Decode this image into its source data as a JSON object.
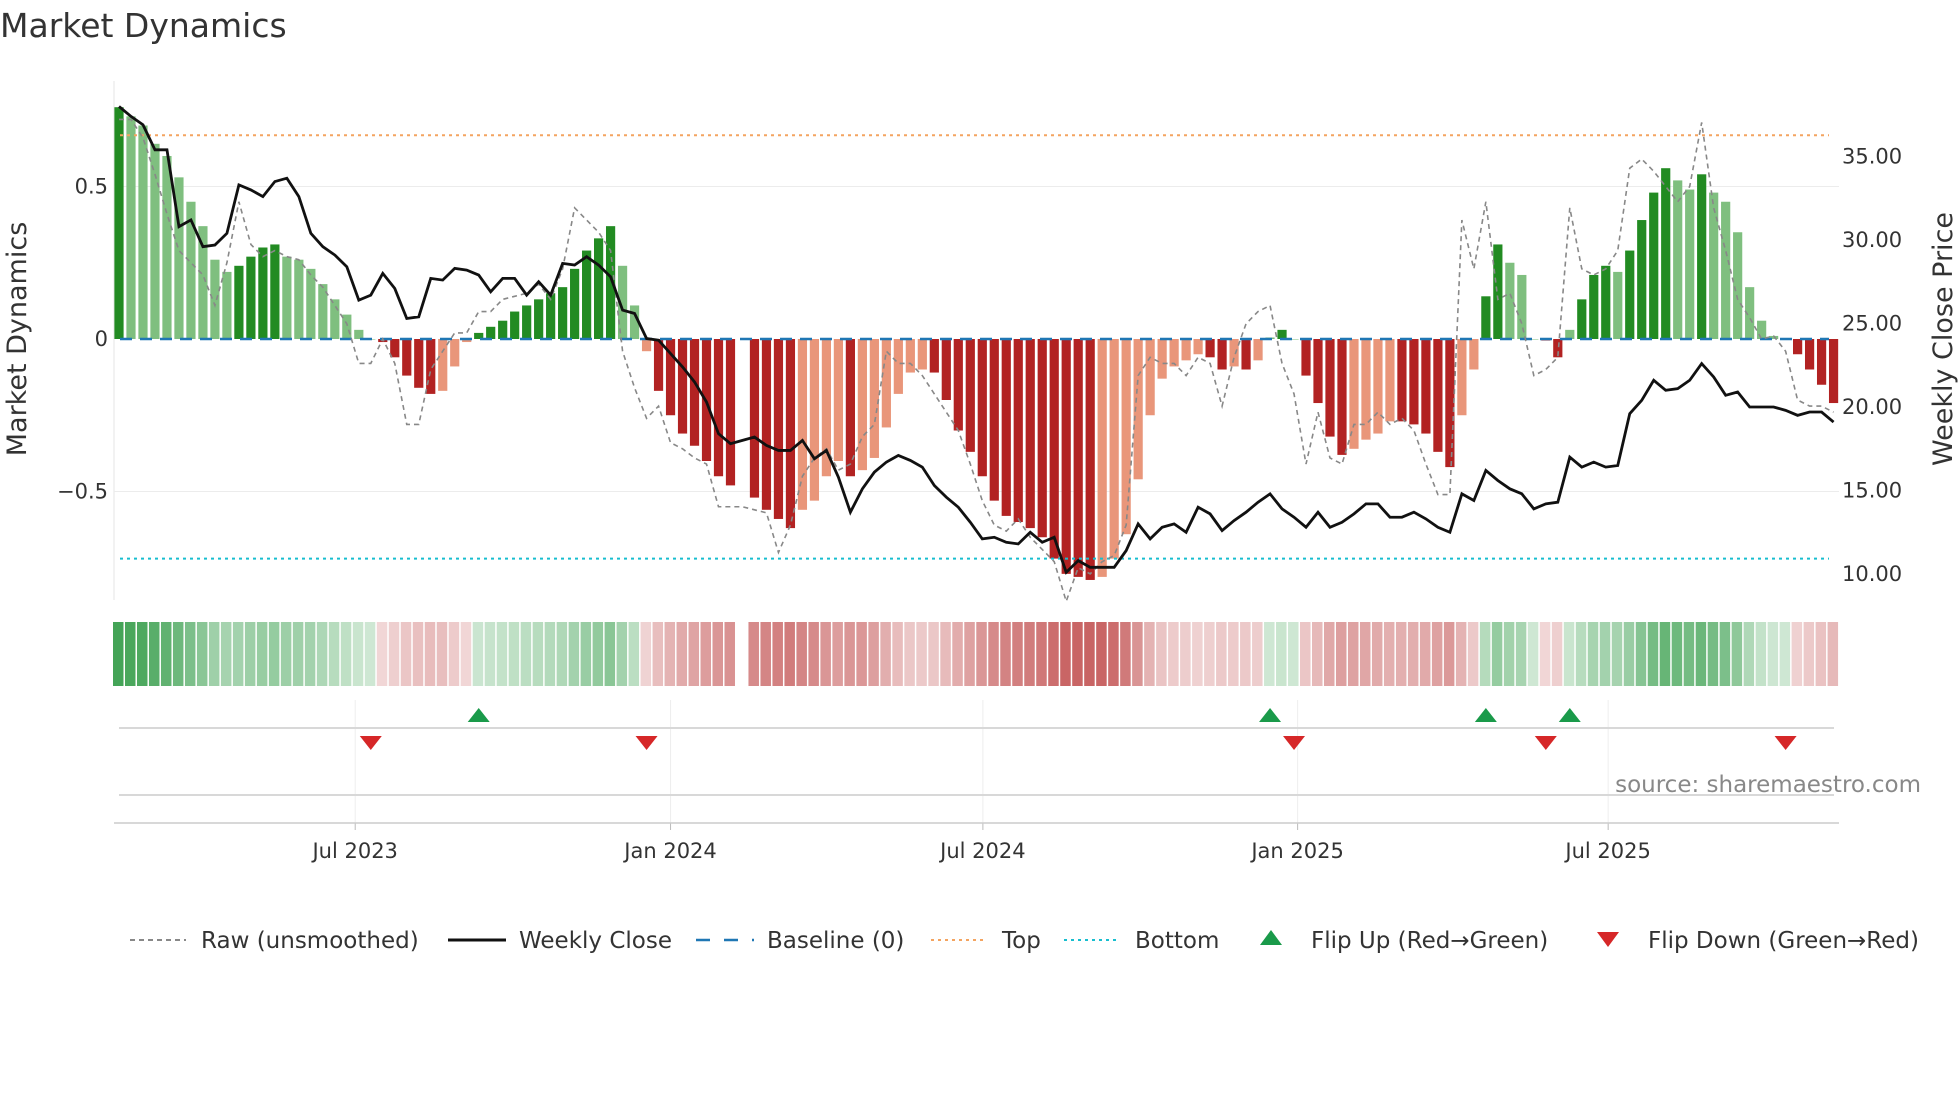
{
  "title": "Market Dynamics",
  "source": "source: sharemaestro.com",
  "colors": {
    "up_strong": "#228b22",
    "up_weak": "#7fbf7f",
    "down_strong": "#b22222",
    "down_weak": "#e9967a",
    "baseline": "#1f77b4",
    "top": "#f4a460",
    "bottom": "#17becf",
    "flip_up": "#1a9a4a",
    "flip_down": "#d62728",
    "close": "#111111",
    "raw": "#888888"
  },
  "chart_data": {
    "type": "bar",
    "title": "Market Dynamics",
    "ylabel": "Market Dynamics",
    "y2label": "Weekly Close Price",
    "ylim": [
      -0.86,
      0.84
    ],
    "y2lim": [
      8.6,
      39.0
    ],
    "yticks": [
      {
        "v": 0.5,
        "label": "0.5"
      },
      {
        "v": 0,
        "label": "0"
      },
      {
        "v": -0.5,
        "label": "−0.5"
      }
    ],
    "y2ticks": [
      {
        "v": 35,
        "label": "35.00"
      },
      {
        "v": 30,
        "label": "30.00"
      },
      {
        "v": 25,
        "label": "25.00"
      },
      {
        "v": 20,
        "label": "20.00"
      },
      {
        "v": 15,
        "label": "15.00"
      },
      {
        "v": 10,
        "label": "10.00"
      }
    ],
    "xticks": [
      {
        "week": 19.7,
        "label": "Jul 2023"
      },
      {
        "week": 46.0,
        "label": "Jan 2024"
      },
      {
        "week": 72.05,
        "label": "Jul 2024"
      },
      {
        "week": 98.3,
        "label": "Jan 2025"
      },
      {
        "week": 124.2,
        "label": "Jul 2025"
      }
    ],
    "top": 0.668,
    "bottom": -0.72,
    "baseline": 0,
    "momentum": [
      0.76,
      0.73,
      0.7,
      0.64,
      0.6,
      0.53,
      0.45,
      0.37,
      0.26,
      0.22,
      0.24,
      0.27,
      0.3,
      0.31,
      0.27,
      0.26,
      0.23,
      0.18,
      0.13,
      0.08,
      0.03,
      0.0,
      -0.01,
      -0.06,
      -0.12,
      -0.16,
      -0.18,
      -0.17,
      -0.09,
      -0.01,
      0.02,
      0.04,
      0.06,
      0.09,
      0.11,
      0.13,
      0.15,
      0.17,
      0.23,
      0.29,
      0.33,
      0.37,
      0.24,
      0.11,
      -0.04,
      -0.17,
      -0.25,
      -0.31,
      -0.35,
      -0.4,
      -0.45,
      -0.48,
      null,
      -0.52,
      -0.56,
      -0.59,
      -0.62,
      -0.56,
      -0.53,
      -0.45,
      -0.4,
      -0.45,
      -0.43,
      -0.39,
      -0.29,
      -0.18,
      -0.11,
      -0.1,
      -0.11,
      -0.2,
      -0.3,
      -0.37,
      -0.45,
      -0.53,
      -0.58,
      -0.6,
      -0.62,
      -0.65,
      -0.72,
      -0.77,
      -0.78,
      -0.79,
      -0.78,
      -0.72,
      -0.64,
      -0.46,
      -0.25,
      -0.13,
      -0.09,
      -0.07,
      -0.05,
      -0.06,
      -0.1,
      -0.09,
      -0.1,
      -0.07,
      0.005,
      0.03,
      0.0,
      -0.12,
      -0.21,
      -0.32,
      -0.38,
      -0.36,
      -0.33,
      -0.31,
      -0.27,
      -0.27,
      -0.28,
      -0.31,
      -0.37,
      -0.42,
      -0.25,
      -0.1,
      0.14,
      0.31,
      0.25,
      0.21,
      0.0,
      -0.005,
      -0.06,
      0.03,
      0.13,
      0.21,
      0.24,
      0.22,
      0.29,
      0.39,
      0.48,
      0.56,
      0.52,
      0.49,
      0.54,
      0.48,
      0.45,
      0.35,
      0.17,
      0.06,
      0.01,
      0.0,
      -0.05,
      -0.1,
      -0.15,
      -0.21
    ],
    "raw": [
      0.72,
      0.72,
      0.66,
      0.54,
      0.41,
      0.29,
      0.25,
      0.21,
      0.11,
      0.25,
      0.45,
      0.31,
      0.27,
      0.29,
      0.27,
      0.26,
      0.21,
      0.17,
      0.11,
      0.05,
      -0.08,
      -0.08,
      0.0,
      -0.08,
      -0.28,
      -0.28,
      -0.1,
      -0.04,
      0.02,
      0.02,
      0.09,
      0.09,
      0.13,
      0.14,
      0.15,
      0.18,
      0.13,
      0.23,
      0.43,
      0.39,
      0.35,
      0.29,
      -0.04,
      -0.16,
      -0.26,
      -0.22,
      -0.34,
      -0.36,
      -0.39,
      -0.41,
      -0.55,
      -0.55,
      -0.55,
      -0.56,
      -0.57,
      -0.7,
      -0.61,
      -0.45,
      -0.39,
      -0.36,
      -0.43,
      -0.41,
      -0.32,
      -0.28,
      -0.04,
      -0.08,
      -0.08,
      -0.12,
      -0.18,
      -0.24,
      -0.3,
      -0.41,
      -0.53,
      -0.61,
      -0.63,
      -0.59,
      -0.65,
      -0.69,
      -0.73,
      -0.86,
      -0.75,
      -0.77,
      -0.73,
      -0.71,
      -0.61,
      -0.12,
      -0.06,
      -0.08,
      -0.08,
      -0.12,
      -0.06,
      -0.08,
      -0.22,
      -0.06,
      0.05,
      0.09,
      0.11,
      -0.08,
      -0.18,
      -0.41,
      -0.24,
      -0.39,
      -0.41,
      -0.28,
      -0.28,
      -0.24,
      -0.28,
      -0.26,
      -0.3,
      -0.41,
      -0.51,
      -0.51,
      0.39,
      0.23,
      0.45,
      0.13,
      0.15,
      0.05,
      -0.12,
      -0.1,
      -0.06,
      0.43,
      0.23,
      0.21,
      0.23,
      0.29,
      0.56,
      0.59,
      0.55,
      0.5,
      0.45,
      0.5,
      0.71,
      0.43,
      0.29,
      0.13,
      0.07,
      0.0,
      0.01,
      -0.04,
      -0.2,
      -0.22,
      -0.22,
      -0.24
    ],
    "close": [
      38.0,
      37.4,
      36.9,
      35.4,
      35.4,
      30.8,
      31.2,
      29.6,
      29.7,
      30.4,
      33.3,
      33.0,
      32.6,
      33.5,
      33.7,
      32.6,
      30.4,
      29.6,
      29.1,
      28.4,
      26.4,
      26.7,
      28.0,
      27.1,
      25.3,
      25.4,
      27.7,
      27.6,
      28.3,
      28.2,
      27.9,
      26.9,
      27.7,
      27.7,
      26.7,
      27.5,
      26.7,
      28.6,
      28.5,
      29.0,
      28.5,
      27.8,
      25.8,
      25.6,
      24.1,
      24.0,
      23.2,
      22.4,
      21.5,
      20.3,
      18.4,
      17.8,
      18.0,
      18.2,
      17.7,
      17.4,
      17.4,
      18.0,
      16.9,
      17.4,
      15.8,
      13.7,
      15.1,
      16.1,
      16.7,
      17.1,
      16.8,
      16.4,
      15.3,
      14.6,
      14.0,
      13.1,
      12.1,
      12.2,
      11.9,
      11.8,
      12.5,
      11.9,
      12.2,
      10.1,
      10.8,
      10.4,
      10.4,
      10.4,
      11.4,
      13.0,
      12.1,
      12.8,
      13.0,
      12.5,
      14.0,
      13.6,
      12.6,
      13.2,
      13.7,
      14.3,
      14.8,
      13.9,
      13.4,
      12.8,
      13.7,
      12.8,
      13.1,
      13.6,
      14.2,
      14.2,
      13.4,
      13.4,
      13.7,
      13.3,
      12.8,
      12.5,
      14.8,
      14.4,
      16.2,
      15.6,
      15.1,
      14.8,
      13.9,
      14.2,
      14.3,
      17.0,
      16.4,
      16.7,
      16.4,
      16.5,
      19.6,
      20.4,
      21.6,
      21.0,
      21.1,
      21.6,
      22.6,
      21.8,
      20.7,
      20.9,
      20.0,
      20.0,
      20.0,
      19.8,
      19.5,
      19.7,
      19.7,
      19.1
    ],
    "flip_up_weeks": [
      30,
      96,
      114,
      121
    ],
    "flip_down_weeks": [
      21,
      44,
      98,
      119,
      139
    ],
    "legend": {
      "placement": "bottom",
      "items": [
        {
          "key": "raw",
          "label": "Raw (unsmoothed)"
        },
        {
          "key": "close",
          "label": "Weekly Close"
        },
        {
          "key": "baseline",
          "label": "Baseline (0)"
        },
        {
          "key": "top",
          "label": "Top"
        },
        {
          "key": "bottom",
          "label": "Bottom"
        },
        {
          "key": "flip_up",
          "label": "Flip Up (Red→Green)"
        },
        {
          "key": "flip_down",
          "label": "Flip Down (Green→Red)"
        }
      ]
    }
  }
}
